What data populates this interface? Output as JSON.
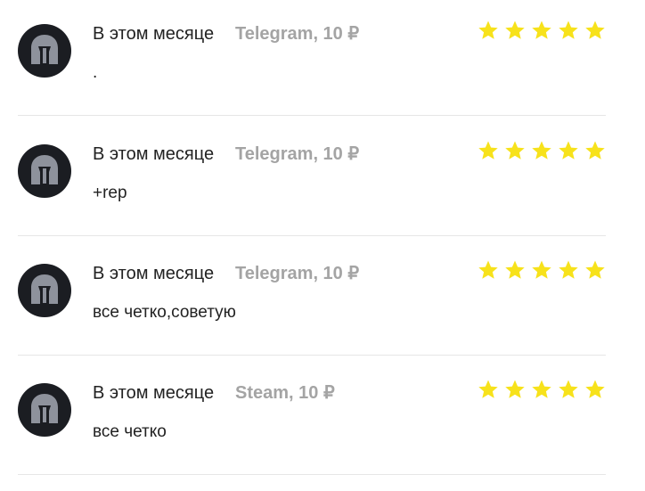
{
  "reviews": [
    {
      "period": "В этом месяце",
      "product": "Telegram, 10 ₽",
      "comment": ".",
      "rating": 5,
      "avatar_icon": "spartan-helmet-icon"
    },
    {
      "period": "В этом месяце",
      "product": "Telegram, 10 ₽",
      "comment": "+rep",
      "rating": 5,
      "avatar_icon": "spartan-helmet-icon"
    },
    {
      "period": "В этом месяце",
      "product": "Telegram, 10 ₽",
      "comment": "все четко,советую",
      "rating": 5,
      "avatar_icon": "spartan-helmet-icon"
    },
    {
      "period": "В этом месяце",
      "product": "Steam, 10 ₽",
      "comment": "все четко",
      "rating": 5,
      "avatar_icon": "spartan-helmet-icon"
    }
  ],
  "colors": {
    "star": "#f7e21b",
    "avatar_bg": "#1b1d22",
    "helmet": "#8e929c",
    "product_text": "#a4a4a4",
    "divider": "#e6e6e6"
  }
}
